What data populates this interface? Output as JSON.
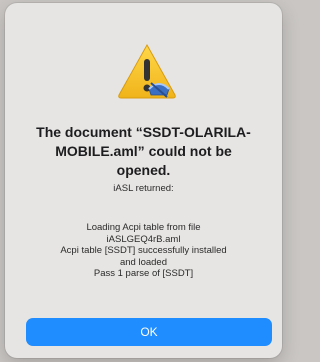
{
  "alert": {
    "title_line1": "The document “SSDT-OLARILA-",
    "title_line2": "MOBILE.aml” could not be",
    "title_line3": "opened.",
    "subtitle": "iASL returned:",
    "details": [
      "Loading Acpi table from file",
      "iASLGEQ4rB.aml",
      "Acpi table [SSDT] successfully installed",
      "and loaded",
      "Pass 1 parse of [SSDT]"
    ],
    "ok_label": "OK"
  },
  "icons": {
    "alert": "warning-icon"
  },
  "colors": {
    "accent": "#1f8cff",
    "dialog_bg": "#e7e5e3",
    "warning": "#f5c024"
  }
}
